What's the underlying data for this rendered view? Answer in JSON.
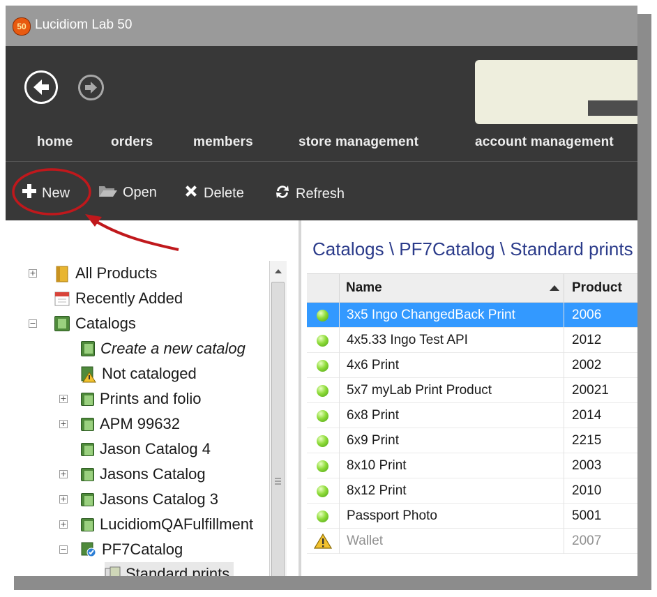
{
  "window": {
    "logo_text": "50",
    "title": "Lucidiom Lab 50"
  },
  "menu": [
    {
      "label": "home"
    },
    {
      "label": "orders"
    },
    {
      "label": "members"
    },
    {
      "label": "store management"
    },
    {
      "label": "account management"
    }
  ],
  "toolbar": {
    "new_label": "New",
    "open_label": "Open",
    "delete_label": "Delete",
    "refresh_label": "Refresh"
  },
  "tree": {
    "all_products": "All Products",
    "recently_added": "Recently Added",
    "catalogs": "Catalogs",
    "create_new": "Create a new catalog",
    "not_cataloged": "Not cataloged",
    "items": [
      {
        "label": " Prints and folio"
      },
      {
        "label": "APM 99632"
      },
      {
        "label": "Jason Catalog 4"
      },
      {
        "label": "Jasons Catalog"
      },
      {
        "label": "Jasons Catalog 3"
      },
      {
        "label": "LucidiomQAFulfillment"
      },
      {
        "label": "PF7Catalog"
      }
    ],
    "standard_prints": "Standard prints"
  },
  "main": {
    "breadcrumb": "Catalogs \\ PF7Catalog \\ Standard prints",
    "columns": {
      "name": "Name",
      "product_id": "Product ID"
    },
    "rows": [
      {
        "name": "3x5 Ingo ChangedBack Print",
        "id": "2006",
        "status": "ok",
        "selected": true
      },
      {
        "name": "4x5.33 Ingo Test API",
        "id": "2012",
        "status": "ok"
      },
      {
        "name": "4x6 Print",
        "id": "2002",
        "status": "ok"
      },
      {
        "name": "5x7 myLab Print Product",
        "id": "20021",
        "status": "ok"
      },
      {
        "name": "6x8 Print",
        "id": "2014",
        "status": "ok"
      },
      {
        "name": "6x9 Print",
        "id": "2215",
        "status": "ok"
      },
      {
        "name": "8x10 Print",
        "id": "2003",
        "status": "ok"
      },
      {
        "name": "8x12 Print",
        "id": "2010",
        "status": "ok"
      },
      {
        "name": "Passport Photo",
        "id": "5001",
        "status": "ok"
      },
      {
        "name": "Wallet",
        "id": "2007",
        "status": "warning"
      }
    ]
  },
  "colors": {
    "title_bar": "#9a9a9a",
    "dark_bar": "#383838",
    "selected_row": "#3399ff",
    "breadcrumb": "#2b3b8a",
    "annotation": "#c0181c"
  }
}
